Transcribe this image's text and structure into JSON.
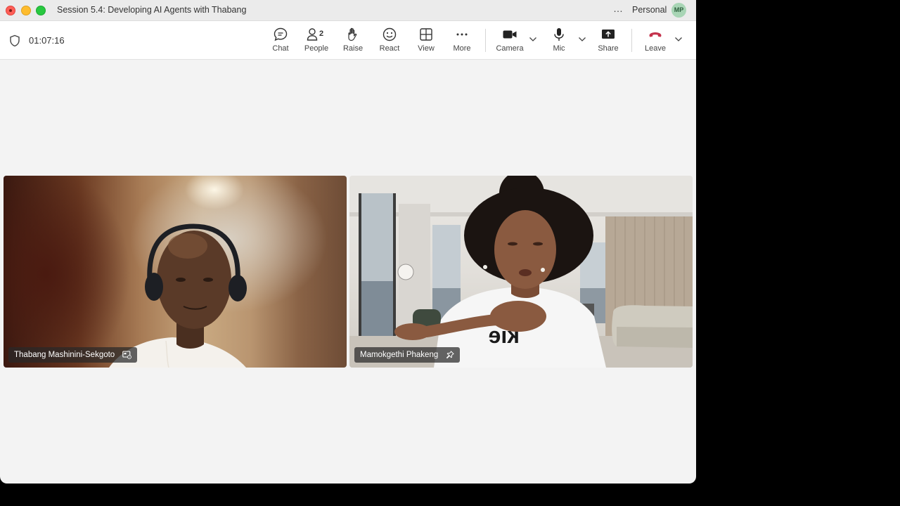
{
  "window": {
    "title": "Session 5.4: Developing AI Agents with Thabang",
    "more_label": "…",
    "profile": "Personal",
    "avatar_initials": "MP"
  },
  "toolbar": {
    "timer": "01:07:16",
    "buttons": {
      "chat": "Chat",
      "people": "People",
      "people_count": "2",
      "raise": "Raise",
      "react": "React",
      "view": "View",
      "more": "More",
      "camera": "Camera",
      "mic": "Mic",
      "share": "Share",
      "leave": "Leave"
    }
  },
  "participants": [
    {
      "name": "Thabang Mashinini-Sekgoto",
      "icon": "screen-share-settings-icon"
    },
    {
      "name": "Mamokgethi Phakeng",
      "icon": "pin-icon"
    }
  ],
  "colors": {
    "leave_red": "#c4314b",
    "avatar_bg": "#a8d5b5"
  }
}
